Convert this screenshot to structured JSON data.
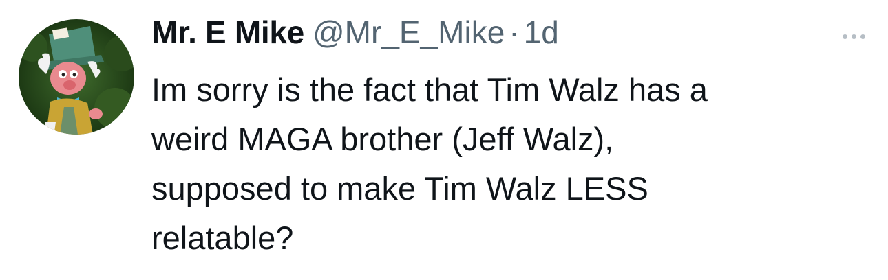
{
  "tweet": {
    "author": {
      "display_name": "Mr. E Mike",
      "handle": "@Mr_E_Mike",
      "avatar_icon": "mad-hatter-avatar-icon",
      "avatar_hat_tag": "10/6"
    },
    "separator": "·",
    "timestamp": "1d",
    "text": "Im sorry is the fact that Tim Walz has a\nweird MAGA brother (Jeff Walz),\nsupposed to make Tim Walz LESS\nrelatable?",
    "more_icon": "more-options-icon"
  }
}
